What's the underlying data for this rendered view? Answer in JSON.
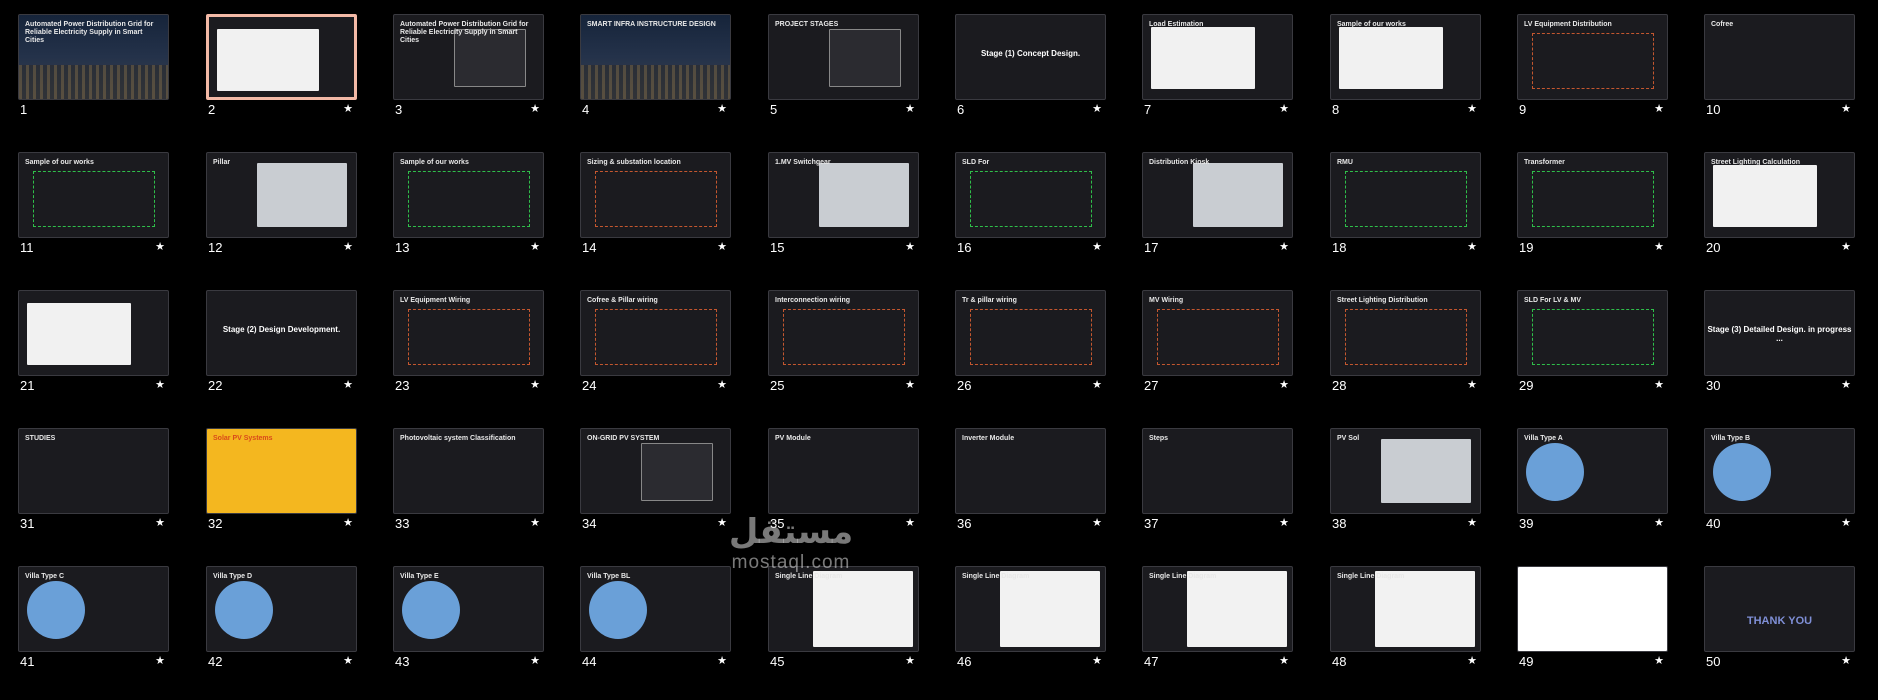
{
  "slides": [
    {
      "n": "1",
      "title": "Automated Power Distribution Grid for Reliable Electricity Supply in Smart Cities",
      "kind": "city"
    },
    {
      "n": "2",
      "title": "",
      "kind": "doc",
      "selected": true
    },
    {
      "n": "3",
      "title": "Automated Power Distribution Grid for Reliable Electricity Supply in Smart Cities",
      "kind": "diagram"
    },
    {
      "n": "4",
      "title": "SMART INFRA INSTRUCTURE DESIGN",
      "kind": "city"
    },
    {
      "n": "5",
      "title": "PROJECT STAGES",
      "kind": "blocks"
    },
    {
      "n": "6",
      "title": "Stage (1) Concept Design.",
      "kind": "stage"
    },
    {
      "n": "7",
      "title": "Load Estimation",
      "kind": "doc2"
    },
    {
      "n": "8",
      "title": "Sample of our works",
      "kind": "table"
    },
    {
      "n": "9",
      "title": "LV Equipment Distribution",
      "kind": "map"
    },
    {
      "n": "10",
      "title": "Cofree",
      "kind": "text"
    },
    {
      "n": "11",
      "title": "Sample of our works",
      "kind": "lineart"
    },
    {
      "n": "12",
      "title": "Pillar",
      "kind": "photo"
    },
    {
      "n": "13",
      "title": "Sample of our works",
      "kind": "lineart"
    },
    {
      "n": "14",
      "title": "Sizing & substation location",
      "kind": "map"
    },
    {
      "n": "15",
      "title": "1.MV Switchgear",
      "kind": "photo"
    },
    {
      "n": "16",
      "title": "SLD For",
      "kind": "lineart"
    },
    {
      "n": "17",
      "title": "Distribution Kiosk",
      "kind": "photo"
    },
    {
      "n": "18",
      "title": "RMU",
      "kind": "lineart"
    },
    {
      "n": "19",
      "title": "Transformer",
      "kind": "lineart"
    },
    {
      "n": "20",
      "title": "Street Lighting Calculation",
      "kind": "doc3"
    },
    {
      "n": "21",
      "title": "",
      "kind": "doc3"
    },
    {
      "n": "22",
      "title": "Stage (2) Design Development.",
      "kind": "stage"
    },
    {
      "n": "23",
      "title": "LV Equipment Wiring",
      "kind": "map"
    },
    {
      "n": "24",
      "title": "Cofree & Pillar wiring",
      "kind": "map"
    },
    {
      "n": "25",
      "title": "Interconnection wiring",
      "kind": "map"
    },
    {
      "n": "26",
      "title": "Tr & pillar wiring",
      "kind": "map"
    },
    {
      "n": "27",
      "title": "MV Wiring",
      "kind": "map"
    },
    {
      "n": "28",
      "title": "Street Lighting Distribution",
      "kind": "map"
    },
    {
      "n": "29",
      "title": "SLD For LV & MV",
      "kind": "lineart"
    },
    {
      "n": "30",
      "title": "Stage (3) Detailed Design. in progress ...",
      "kind": "stage"
    },
    {
      "n": "31",
      "title": "STUDIES",
      "kind": "text"
    },
    {
      "n": "32",
      "title": "Solar PV Systems",
      "kind": "solar"
    },
    {
      "n": "33",
      "title": "Photovoltaic system Classification",
      "kind": "text"
    },
    {
      "n": "34",
      "title": "ON-GRID PV SYSTEM",
      "kind": "diagram"
    },
    {
      "n": "35",
      "title": "PV Module",
      "kind": "text"
    },
    {
      "n": "36",
      "title": "Inverter Module",
      "kind": "text"
    },
    {
      "n": "37",
      "title": "Steps",
      "kind": "text"
    },
    {
      "n": "38",
      "title": "PV Sol",
      "kind": "photo"
    },
    {
      "n": "39",
      "title": "Villa Type A",
      "kind": "villa"
    },
    {
      "n": "40",
      "title": "Villa Type B",
      "kind": "villa"
    },
    {
      "n": "41",
      "title": "Villa Type C",
      "kind": "villa"
    },
    {
      "n": "42",
      "title": "Villa Type D",
      "kind": "villa"
    },
    {
      "n": "43",
      "title": "Villa Type E",
      "kind": "villa"
    },
    {
      "n": "44",
      "title": "Villa Type BL",
      "kind": "villa"
    },
    {
      "n": "45",
      "title": "Single Line Diagram",
      "kind": "sld"
    },
    {
      "n": "46",
      "title": "Single Line Diagram",
      "kind": "sld"
    },
    {
      "n": "47",
      "title": "Single Line Diagram",
      "kind": "sld"
    },
    {
      "n": "48",
      "title": "Single Line Diagram",
      "kind": "sld"
    },
    {
      "n": "49",
      "title": "",
      "kind": "white"
    },
    {
      "n": "50",
      "title": "THANK YOU",
      "kind": "thanks"
    }
  ],
  "star_glyph": "★",
  "watermark": {
    "arabic": "مستقل",
    "latin": "mostaql.com"
  }
}
